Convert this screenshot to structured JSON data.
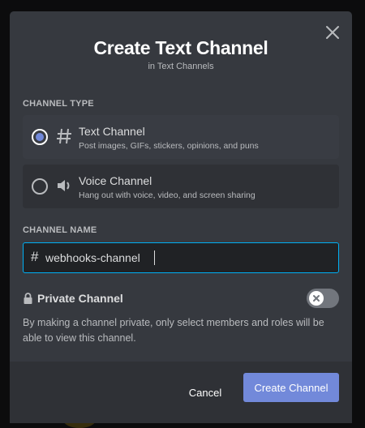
{
  "modal": {
    "title": "Create Text Channel",
    "subtitle": "in Text Channels"
  },
  "channel_type": {
    "label": "CHANNEL TYPE",
    "selected": "text",
    "options": [
      {
        "id": "text",
        "icon": "hash-icon",
        "name": "Text Channel",
        "description": "Post images, GIFs, stickers, opinions, and puns"
      },
      {
        "id": "voice",
        "icon": "speaker-icon",
        "name": "Voice Channel",
        "description": "Hang out with voice, video, and screen sharing"
      }
    ]
  },
  "channel_name": {
    "label": "CHANNEL NAME",
    "prefix": "#",
    "value": "webhooks-channel"
  },
  "private": {
    "label": "Private Channel",
    "enabled": false,
    "description": "By making a channel private, only select members and roles will be able to view this channel."
  },
  "footer": {
    "cancel_label": "Cancel",
    "create_label": "Create Channel"
  },
  "colors": {
    "accent": "#7289da",
    "focus_border": "#00b0f4",
    "modal_bg": "#36393f",
    "footer_bg": "#2f3136"
  }
}
